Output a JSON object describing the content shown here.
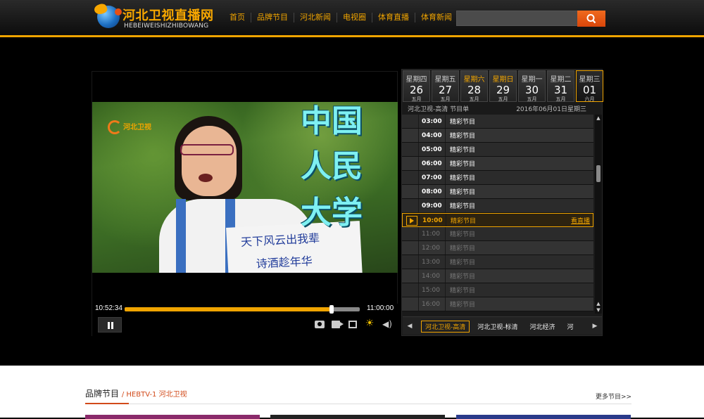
{
  "header": {
    "logo_cn": "河北卫视直播网",
    "logo_en": "HEBEIWEISHIZHIBOWANG",
    "nav": [
      "首页",
      "品牌节目",
      "河北新闻",
      "电视圈",
      "体育直播",
      "体育新闻"
    ],
    "search_placeholder": ""
  },
  "player": {
    "channel_watermark": "河北卫视",
    "overlay_text": [
      "中国",
      "人民",
      "大学"
    ],
    "sign_text": [
      "天下风云出我辈",
      "诗酒趁年华"
    ],
    "current_time": "10:52:34",
    "end_time": "11:00:00",
    "progress": 0.88
  },
  "schedule": {
    "days": [
      {
        "weekday": "星期四",
        "day": "26",
        "month": "五月"
      },
      {
        "weekday": "星期五",
        "day": "27",
        "month": "五月"
      },
      {
        "weekday": "星期六",
        "day": "28",
        "month": "五月"
      },
      {
        "weekday": "星期日",
        "day": "29",
        "month": "五月"
      },
      {
        "weekday": "星期一",
        "day": "30",
        "month": "五月"
      },
      {
        "weekday": "星期二",
        "day": "31",
        "month": "五月"
      },
      {
        "weekday": "星期三",
        "day": "01",
        "month": "六月"
      }
    ],
    "channel_label": "河北卫视-高清  节目单",
    "date_label": "2016年06月01日星期三",
    "rows": [
      {
        "time": "03:00",
        "program": "精彩节目",
        "state": "future"
      },
      {
        "time": "04:00",
        "program": "精彩节目",
        "state": "future"
      },
      {
        "time": "05:00",
        "program": "精彩节目",
        "state": "future"
      },
      {
        "time": "06:00",
        "program": "精彩节目",
        "state": "future"
      },
      {
        "time": "07:00",
        "program": "精彩节目",
        "state": "future"
      },
      {
        "time": "08:00",
        "program": "精彩节目",
        "state": "future"
      },
      {
        "time": "09:00",
        "program": "精彩节目",
        "state": "future"
      },
      {
        "time": "10:00",
        "program": "精彩节目",
        "state": "live",
        "link": "看直播"
      },
      {
        "time": "11:00",
        "program": "精彩节目",
        "state": "past"
      },
      {
        "time": "12:00",
        "program": "精彩节目",
        "state": "past"
      },
      {
        "time": "13:00",
        "program": "精彩节目",
        "state": "past"
      },
      {
        "time": "14:00",
        "program": "精彩节目",
        "state": "past"
      },
      {
        "time": "15:00",
        "program": "精彩节目",
        "state": "past"
      },
      {
        "time": "16:00",
        "program": "精彩节目",
        "state": "past"
      }
    ],
    "channels": [
      "河北卫视-高清",
      "河北卫视-标清",
      "河北经济",
      "河"
    ]
  },
  "section": {
    "title": "品牌节目",
    "subtitle": "/ HEBTV-1 河北卫视",
    "more": "更多节目>>"
  },
  "colors": {
    "accent": "#f0a400",
    "search_button": "#e0520f",
    "section_accent": "#d24a1a"
  }
}
